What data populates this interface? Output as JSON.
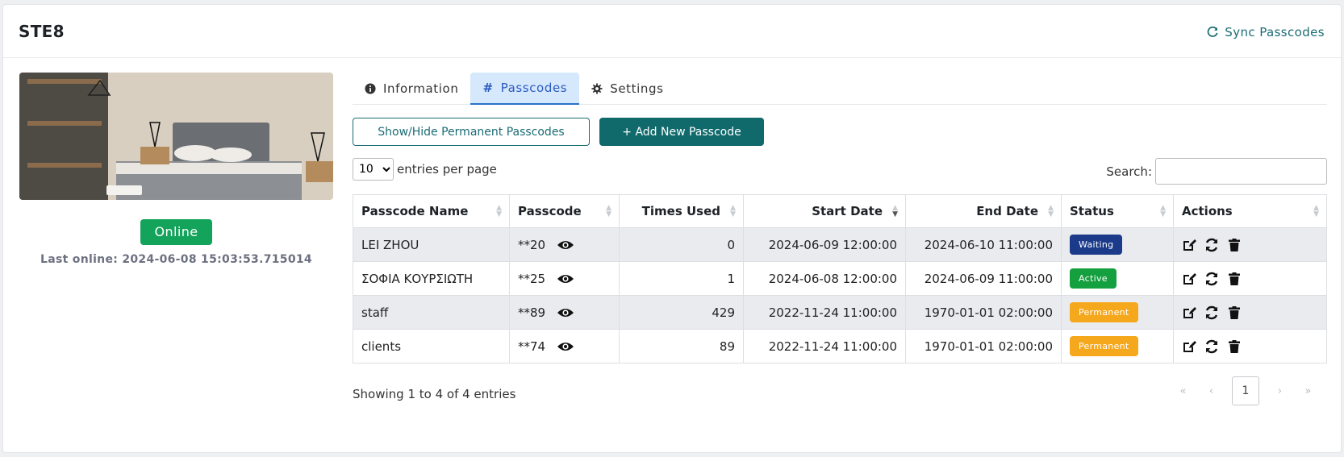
{
  "header": {
    "title": "STE8",
    "sync_label": "Sync Passcodes"
  },
  "device": {
    "status": "Online",
    "last_online": "Last online: 2024-06-08 15:03:53.715014"
  },
  "tabs": [
    {
      "label": "Information"
    },
    {
      "label": "Passcodes"
    },
    {
      "label": "Settings"
    }
  ],
  "buttons": {
    "toggle_permanent": "Show/Hide Permanent Passcodes",
    "add_new": "+ Add New Passcode"
  },
  "table_controls": {
    "per_page_value": "10",
    "per_page_label": "entries per page",
    "search_label": "Search:",
    "search_value": ""
  },
  "columns": {
    "name": "Passcode Name",
    "passcode": "Passcode",
    "times_used": "Times Used",
    "start_date": "Start Date",
    "end_date": "End Date",
    "status": "Status",
    "actions": "Actions"
  },
  "rows": [
    {
      "name": "LEI ZHOU",
      "passcode": "**20",
      "times_used": "0",
      "start_date": "2024-06-09 12:00:00",
      "end_date": "2024-06-10 11:00:00",
      "status": "Waiting"
    },
    {
      "name": "ΣΟΦΙΑ ΚΟΥΡΣΙΩΤΗ",
      "passcode": "**25",
      "times_used": "1",
      "start_date": "2024-06-08 12:00:00",
      "end_date": "2024-06-09 11:00:00",
      "status": "Active"
    },
    {
      "name": "staff",
      "passcode": "**89",
      "times_used": "429",
      "start_date": "2022-11-24 11:00:00",
      "end_date": "1970-01-01 02:00:00",
      "status": "Permanent"
    },
    {
      "name": "clients",
      "passcode": "**74",
      "times_used": "89",
      "start_date": "2022-11-24 11:00:00",
      "end_date": "1970-01-01 02:00:00",
      "status": "Permanent"
    }
  ],
  "footer": {
    "info": "Showing 1 to 4 of 4 entries",
    "first": "«",
    "prev": "‹",
    "current_page": "1",
    "next": "›",
    "last": "»"
  },
  "colors": {
    "accent": "#106a6c",
    "tab_active_bg": "#d6e8fb",
    "online": "#13a35a",
    "waiting": "#1b3a8a",
    "active": "#14a03f",
    "permanent": "#f6a81c"
  },
  "icons": {
    "sync": "refresh-icon",
    "information": "info-circle-icon",
    "passcodes": "hash-icon",
    "settings": "gear-icon",
    "reveal": "eye-icon",
    "edit": "edit-icon",
    "regenerate": "refresh-icon",
    "delete": "trash-icon"
  }
}
